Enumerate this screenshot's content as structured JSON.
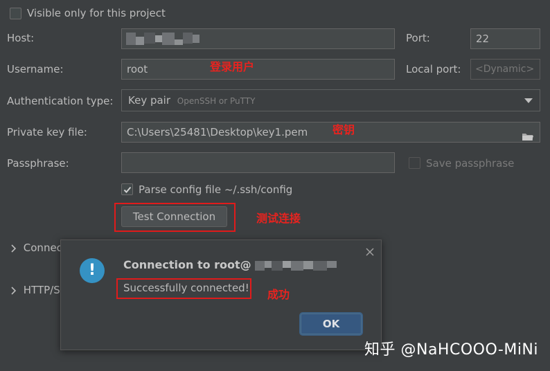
{
  "visible_only_label": "Visible only for this project",
  "host": {
    "label": "Host:"
  },
  "port": {
    "label": "Port:",
    "value": "22"
  },
  "username": {
    "label": "Username:",
    "value": "root"
  },
  "local_port": {
    "label": "Local port:",
    "placeholder": "<Dynamic>"
  },
  "auth": {
    "label": "Authentication type:",
    "value": "Key pair",
    "hint": "OpenSSH or PuTTY"
  },
  "private_key": {
    "label": "Private key file:",
    "value": "C:\\Users\\25481\\Desktop\\key1.pem"
  },
  "passphrase": {
    "label": "Passphrase:",
    "save_label": "Save passphrase"
  },
  "parse_config": {
    "label": "Parse config file ~/.ssh/config",
    "checked": true
  },
  "test_connection_label": "Test Connection",
  "collapsed_sections": [
    "Connec",
    "HTTP/S"
  ],
  "annotations": {
    "login_user": "登录用户",
    "key": "密钥",
    "test_connection": "测试连接",
    "success": "成功"
  },
  "dialog": {
    "title": "Connection to root@",
    "message": "Successfully connected!",
    "ok_label": "OK"
  },
  "watermark": "知乎 @NaHCOOO-MiNi",
  "colors": {
    "background": "#3c3f41",
    "field": "#45494a",
    "accent_button": "#365880",
    "annotation_red": "#e11b1b",
    "info_icon": "#3592c4"
  },
  "icons": [
    "checkbox-icon",
    "dropdown-arrow-icon",
    "folder-icon",
    "chevron-right-icon",
    "info-icon",
    "close-icon"
  ]
}
